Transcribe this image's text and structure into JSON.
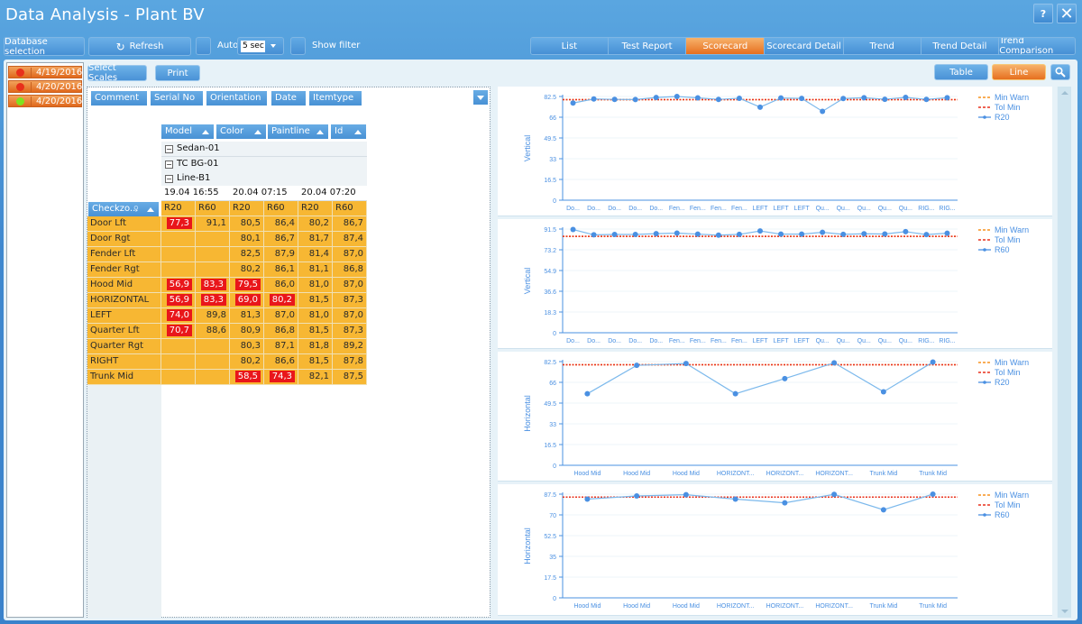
{
  "app": {
    "title": "Data Analysis - Plant BV"
  },
  "window_controls": {
    "help_label": "?",
    "close_label": "✕"
  },
  "toolbar": {
    "database_selection_label": "Database selection",
    "refresh_label": "Refresh",
    "refresh_icon": "↻",
    "auto_label": "Auto",
    "auto_interval_value": "5 sec",
    "auto_checked": false,
    "show_filter_label": "Show filter",
    "show_filter_checked": false
  },
  "tabs": [
    {
      "label": "List",
      "active": false
    },
    {
      "label": "Test Report",
      "active": false
    },
    {
      "label": "Scorecard",
      "active": true
    },
    {
      "label": "Scorecard Detail",
      "active": false
    },
    {
      "label": "Trend",
      "active": false
    },
    {
      "label": "Trend Detail",
      "active": false
    },
    {
      "label": "Trend Comparison",
      "active": false
    }
  ],
  "dates": [
    {
      "label": "4/19/2016",
      "status": "red",
      "color": "#e8301b"
    },
    {
      "label": "4/20/2016",
      "status": "red",
      "color": "#e8301b"
    },
    {
      "label": "4/20/2016",
      "status": "green",
      "color": "#7fe21d"
    }
  ],
  "actions": {
    "select_scales_label": "Select Scales",
    "print_label": "Print"
  },
  "view": {
    "table_label": "Table",
    "line_label": "Line",
    "search_icon": "search-icon"
  },
  "pivot": {
    "filter_fields": [
      "Comment",
      "Serial No",
      "Orientation",
      "Date",
      "Itemtype"
    ],
    "column_fields": [
      "Model",
      "Color",
      "Paintline",
      "Id"
    ],
    "row_field": "Checkzo...",
    "groups": [
      "Sedan-01",
      "TC BG-01",
      "Line-B1"
    ],
    "timestamps": [
      "19.04 16:55",
      "20.04 07:15",
      "20.04 07:20"
    ],
    "measures": [
      "R20",
      "R60",
      "R20",
      "R60",
      "R20",
      "R60"
    ],
    "rows": [
      {
        "label": "Door Lft",
        "values": [
          "77,3",
          "91,1",
          "80,5",
          "86,4",
          "80,2",
          "86,7"
        ],
        "flags": [
          true,
          false,
          false,
          false,
          false,
          false
        ]
      },
      {
        "label": "Door Rgt",
        "values": [
          "",
          "",
          "80,1",
          "86,7",
          "81,7",
          "87,4"
        ],
        "flags": [
          false,
          false,
          false,
          false,
          false,
          false
        ]
      },
      {
        "label": "Fender Lft",
        "values": [
          "",
          "",
          "82,5",
          "87,9",
          "81,4",
          "87,0"
        ],
        "flags": [
          false,
          false,
          false,
          false,
          false,
          false
        ]
      },
      {
        "label": "Fender Rgt",
        "values": [
          "",
          "",
          "80,2",
          "86,1",
          "81,1",
          "86,8"
        ],
        "flags": [
          false,
          false,
          false,
          false,
          false,
          false
        ]
      },
      {
        "label": "Hood Mid",
        "values": [
          "56,9",
          "83,3",
          "79,5",
          "86,0",
          "81,0",
          "87,0"
        ],
        "flags": [
          true,
          true,
          true,
          false,
          false,
          false
        ]
      },
      {
        "label": "HORIZONTAL",
        "values": [
          "56,9",
          "83,3",
          "69,0",
          "80,2",
          "81,5",
          "87,3"
        ],
        "flags": [
          true,
          true,
          true,
          true,
          false,
          false
        ]
      },
      {
        "label": "LEFT",
        "values": [
          "74,0",
          "89,8",
          "81,3",
          "87,0",
          "81,0",
          "87,0"
        ],
        "flags": [
          true,
          false,
          false,
          false,
          false,
          false
        ]
      },
      {
        "label": "Quarter Lft",
        "values": [
          "70,7",
          "88,6",
          "80,9",
          "86,8",
          "81,5",
          "87,3"
        ],
        "flags": [
          true,
          false,
          false,
          false,
          false,
          false
        ]
      },
      {
        "label": "Quarter Rgt",
        "values": [
          "",
          "",
          "80,3",
          "87,1",
          "81,8",
          "89,2"
        ],
        "flags": [
          false,
          false,
          false,
          false,
          false,
          false
        ]
      },
      {
        "label": "RIGHT",
        "values": [
          "",
          "",
          "80,2",
          "86,6",
          "81,5",
          "87,8"
        ],
        "flags": [
          false,
          false,
          false,
          false,
          false,
          false
        ]
      },
      {
        "label": "Trunk Mid",
        "values": [
          "",
          "",
          "58,5",
          "74,3",
          "82,1",
          "87,5"
        ],
        "flags": [
          false,
          false,
          true,
          true,
          false,
          false
        ]
      }
    ]
  },
  "chart_data": [
    {
      "type": "line",
      "ylabel": "Vertical",
      "yticks": [
        "0",
        "16.5",
        "33",
        "49.5",
        "66",
        "82.5"
      ],
      "ylim": [
        0,
        82.5
      ],
      "categories": [
        "Do...",
        "Do...",
        "Do...",
        "Do...",
        "Do...",
        "Fen...",
        "Fen...",
        "Fen...",
        "Fen...",
        "LEFT",
        "LEFT",
        "LEFT",
        "Qu...",
        "Qu...",
        "Qu...",
        "Qu...",
        "Qu...",
        "RIG...",
        "RIG..."
      ],
      "series": [
        {
          "name": "R20",
          "color": "#4a90e2",
          "values": [
            77.3,
            80.5,
            80.2,
            80.1,
            81.7,
            82.5,
            81.4,
            80.2,
            81.1,
            74.0,
            81.3,
            81.0,
            70.7,
            80.9,
            81.5,
            80.3,
            81.8,
            80.2,
            81.5
          ]
        }
      ],
      "reference_lines": [
        {
          "name": "Min Warn",
          "value": 80,
          "color": "#f7921e"
        },
        {
          "name": "Tol Min",
          "value": 80,
          "color": "#e8301b"
        }
      ],
      "legend": [
        "Min Warn",
        "Tol Min",
        "R20"
      ],
      "legend_position": "top-right",
      "grid": true
    },
    {
      "type": "line",
      "ylabel": "Vertical",
      "yticks": [
        "0",
        "18.3",
        "36.6",
        "54.9",
        "73.2",
        "91.5"
      ],
      "ylim": [
        0,
        91.5
      ],
      "categories": [
        "Do...",
        "Do...",
        "Do...",
        "Do...",
        "Do...",
        "Fen...",
        "Fen...",
        "Fen...",
        "Fen...",
        "LEFT",
        "LEFT",
        "LEFT",
        "Qu...",
        "Qu...",
        "Qu...",
        "Qu...",
        "Qu...",
        "RIG...",
        "RIG..."
      ],
      "series": [
        {
          "name": "R60",
          "color": "#4a90e2",
          "values": [
            91.1,
            86.4,
            86.7,
            86.7,
            87.4,
            87.9,
            87.0,
            86.1,
            86.8,
            89.8,
            87.0,
            87.0,
            88.6,
            86.8,
            87.3,
            87.1,
            89.2,
            86.6,
            87.8
          ]
        }
      ],
      "reference_lines": [
        {
          "name": "Min Warn",
          "value": 85,
          "color": "#f7921e"
        },
        {
          "name": "Tol Min",
          "value": 85,
          "color": "#e8301b"
        }
      ],
      "legend": [
        "Min Warn",
        "Tol Min",
        "R60"
      ],
      "legend_position": "top-right",
      "grid": true
    },
    {
      "type": "line",
      "ylabel": "Horizontal",
      "yticks": [
        "0",
        "16.5",
        "33",
        "49.5",
        "66",
        "82.5"
      ],
      "ylim": [
        0,
        82.5
      ],
      "categories": [
        "Hood Mid",
        "Hood Mid",
        "Hood Mid",
        "HORIZONT...",
        "HORIZONT...",
        "HORIZONT...",
        "Trunk Mid",
        "Trunk Mid"
      ],
      "series": [
        {
          "name": "R20",
          "color": "#4a90e2",
          "values": [
            56.9,
            79.5,
            81.0,
            56.9,
            69.0,
            81.5,
            58.5,
            82.1
          ]
        }
      ],
      "reference_lines": [
        {
          "name": "Min Warn",
          "value": 80,
          "color": "#f7921e"
        },
        {
          "name": "Tol Min",
          "value": 80,
          "color": "#e8301b"
        }
      ],
      "legend": [
        "Min Warn",
        "Tol Min",
        "R20"
      ],
      "legend_position": "top-right",
      "grid": true
    },
    {
      "type": "line",
      "ylabel": "Horizontal",
      "yticks": [
        "0",
        "17.5",
        "35",
        "52.5",
        "70",
        "87.5"
      ],
      "ylim": [
        0,
        87.5
      ],
      "categories": [
        "Hood Mid",
        "Hood Mid",
        "Hood Mid",
        "HORIZONT...",
        "HORIZONT...",
        "HORIZONT...",
        "Trunk Mid",
        "Trunk Mid"
      ],
      "series": [
        {
          "name": "R60",
          "color": "#4a90e2",
          "values": [
            83.3,
            86.0,
            87.0,
            83.3,
            80.2,
            87.3,
            74.3,
            87.5
          ]
        }
      ],
      "reference_lines": [
        {
          "name": "Min Warn",
          "value": 85,
          "color": "#f7921e"
        },
        {
          "name": "Tol Min",
          "value": 85,
          "color": "#e8301b"
        }
      ],
      "legend": [
        "Min Warn",
        "Tol Min",
        "R60"
      ],
      "legend_position": "top-right",
      "grid": true
    }
  ]
}
